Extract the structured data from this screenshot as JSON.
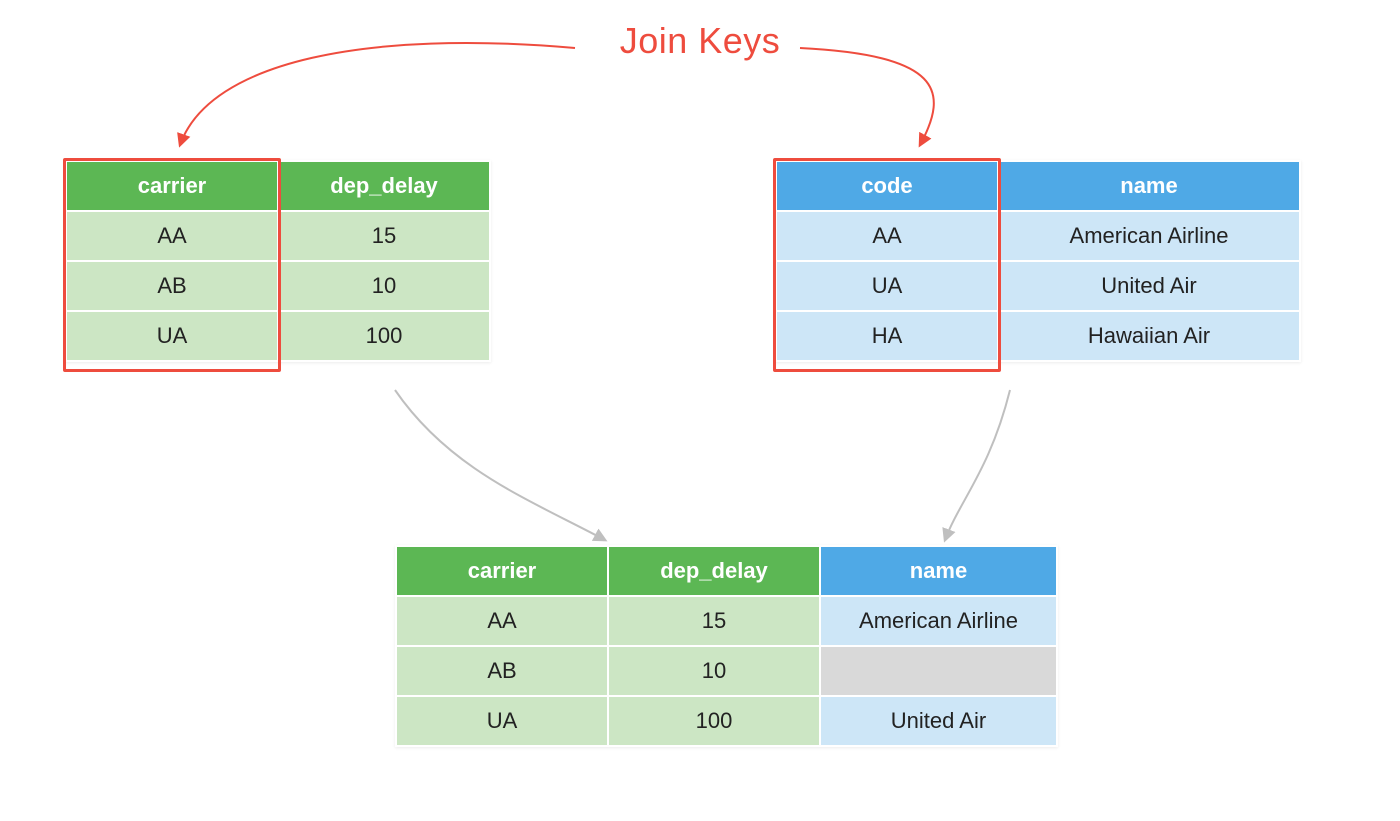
{
  "title": "Join Keys",
  "left_table": {
    "headers": [
      "carrier",
      "dep_delay"
    ],
    "rows": [
      [
        "AA",
        "15"
      ],
      [
        "AB",
        "10"
      ],
      [
        "UA",
        "100"
      ]
    ]
  },
  "right_table": {
    "headers": [
      "code",
      "name"
    ],
    "rows": [
      [
        "AA",
        "American Airline"
      ],
      [
        "UA",
        "United Air"
      ],
      [
        "HA",
        "Hawaiian Air"
      ]
    ]
  },
  "result_table": {
    "headers": [
      "carrier",
      "dep_delay",
      "name"
    ],
    "rows": [
      [
        "AA",
        "15",
        "American Airline"
      ],
      [
        "AB",
        "10",
        ""
      ],
      [
        "UA",
        "100",
        "United Air"
      ]
    ]
  },
  "colors": {
    "green_header": "#5cb754",
    "green_cell": "#cce6c4",
    "blue_header": "#4fa9e6",
    "blue_cell": "#cde6f7",
    "grey_cell": "#d9d9d9",
    "red": "#ee4c3e"
  },
  "chart_data": {
    "type": "table",
    "description": "Illustration of a left join between two tables on carrier=code",
    "join_on": {
      "left": "carrier",
      "right": "code"
    },
    "left": {
      "columns": [
        "carrier",
        "dep_delay"
      ],
      "rows": [
        {
          "carrier": "AA",
          "dep_delay": 15
        },
        {
          "carrier": "AB",
          "dep_delay": 10
        },
        {
          "carrier": "UA",
          "dep_delay": 100
        }
      ]
    },
    "right": {
      "columns": [
        "code",
        "name"
      ],
      "rows": [
        {
          "code": "AA",
          "name": "American Airline"
        },
        {
          "code": "UA",
          "name": "United Air"
        },
        {
          "code": "HA",
          "name": "Hawaiian Air"
        }
      ]
    },
    "result": {
      "columns": [
        "carrier",
        "dep_delay",
        "name"
      ],
      "rows": [
        {
          "carrier": "AA",
          "dep_delay": 15,
          "name": "American Airline"
        },
        {
          "carrier": "AB",
          "dep_delay": 10,
          "name": null
        },
        {
          "carrier": "UA",
          "dep_delay": 100,
          "name": "United Air"
        }
      ]
    }
  }
}
